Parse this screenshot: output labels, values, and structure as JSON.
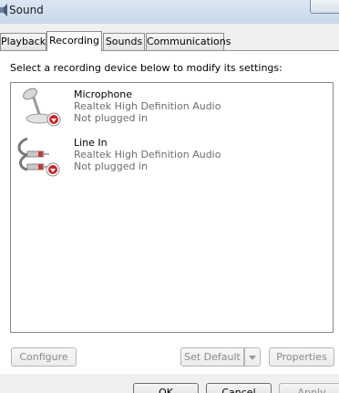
{
  "window": {
    "title": "Sound"
  },
  "tabs": [
    {
      "label": "Playback"
    },
    {
      "label": "Recording"
    },
    {
      "label": "Sounds"
    },
    {
      "label": "Communications"
    }
  ],
  "panel": {
    "instruction": "Select a recording device below to modify its settings:"
  },
  "devices": [
    {
      "name": "Microphone",
      "driver": "Realtek High Definition Audio",
      "status": "Not plugged in",
      "icon": "microphone-icon"
    },
    {
      "name": "Line In",
      "driver": "Realtek High Definition Audio",
      "status": "Not plugged in",
      "icon": "line-in-jack-icon"
    }
  ],
  "buttons": {
    "configure": "Configure",
    "set_default": "Set Default",
    "properties": "Properties",
    "ok": "OK",
    "cancel": "Cancel",
    "apply": "Apply"
  }
}
